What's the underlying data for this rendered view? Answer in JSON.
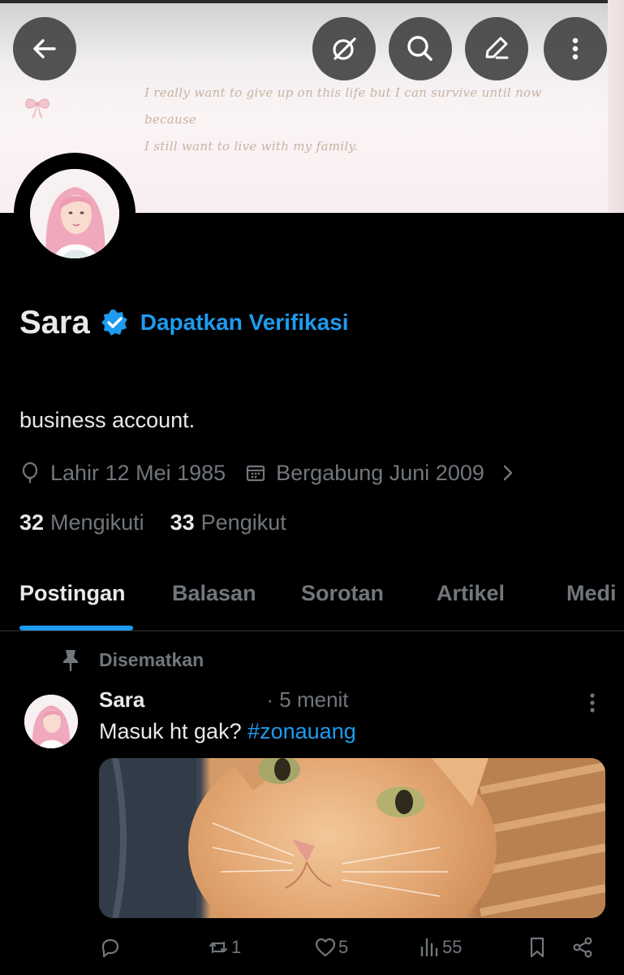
{
  "banner": {
    "quote_line1": "I really want to give up on this life but I can survive until now because",
    "quote_line2": "I still want to live with my family."
  },
  "top_bar": {
    "icons": [
      "back-arrow-icon",
      "grok-icon",
      "search-icon",
      "edit-icon",
      "more-vertical-icon"
    ]
  },
  "profile": {
    "name": "Sara",
    "get_verified_label": "Dapatkan Verifikasi",
    "bio": "business account.",
    "birth": "Lahir 12 Mei 1985",
    "joined": "Bergabung Juni 2009",
    "following_count": "32",
    "following_label": "Mengikuti",
    "followers_count": "33",
    "followers_label": "Pengikut"
  },
  "tabs": [
    {
      "label": "Postingan",
      "active": true
    },
    {
      "label": "Balasan",
      "active": false
    },
    {
      "label": "Sorotan",
      "active": false
    },
    {
      "label": "Artikel",
      "active": false
    },
    {
      "label": "Medi",
      "active": false
    }
  ],
  "post": {
    "pinned_label": "Disematkan",
    "author": "Sara",
    "time": "· 5 menit",
    "text": "Masuk ht gak? ",
    "hashtag": "#zonauang",
    "replies": "",
    "reposts": "1",
    "likes": "5",
    "views": "55"
  },
  "colors": {
    "accent": "#1d9bf0",
    "muted": "#71767b",
    "text": "#e7e9ea",
    "background": "#000000"
  }
}
